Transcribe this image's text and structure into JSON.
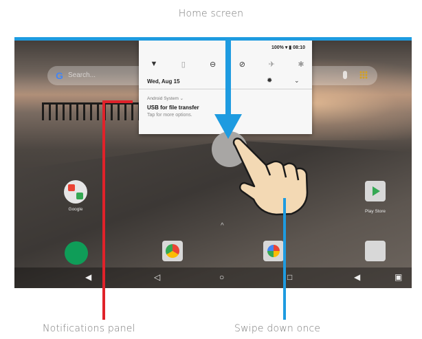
{
  "captions": {
    "top": "Home screen",
    "left": "Notifications panel",
    "right": "Swipe down once"
  },
  "colors": {
    "blue_accent": "#1e9be0",
    "red_pointer": "#e0222a",
    "blue_pointer": "#1e9be0",
    "hand": "#f3d9b4"
  },
  "screen": {
    "search": {
      "placeholder": "Search..."
    },
    "status_bar": {
      "battery": "100%",
      "time": "08:10"
    },
    "notifications": {
      "date": "Wed, Aug 15",
      "source": "Android System ⌄",
      "title": "USB for file transfer",
      "subtitle": "Tap for more options."
    },
    "apps": {
      "google_label": "Google",
      "playstore_label": "Play Store"
    },
    "icons": {
      "quick_settings": [
        "wifi-icon",
        "flashlight-icon",
        "do-not-disturb-icon",
        "rotation-icon",
        "airplane-icon",
        "bluetooth-icon"
      ],
      "nav": [
        "volume-icon",
        "back-icon",
        "home-icon",
        "recents-icon",
        "volume-up-icon",
        "screenshot-icon"
      ]
    }
  }
}
